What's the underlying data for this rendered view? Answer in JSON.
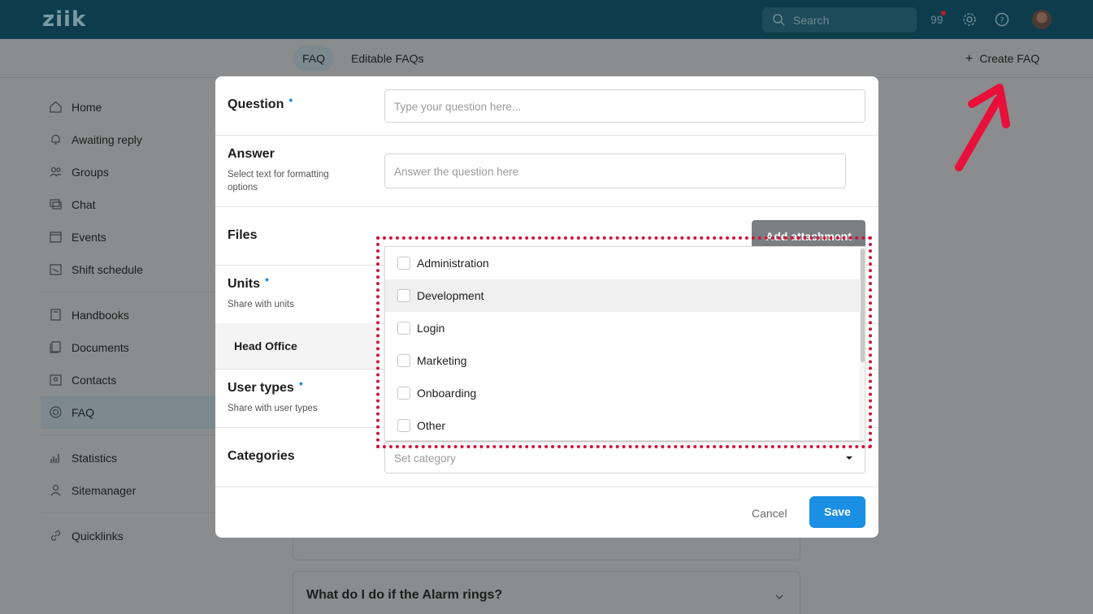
{
  "app": {
    "logo": "ziik"
  },
  "topbar": {
    "search_placeholder": "Search",
    "notification_count": "99",
    "icons": [
      "search-icon",
      "gear-icon",
      "help-icon"
    ]
  },
  "tabs": [
    {
      "label": "FAQ",
      "active": true
    },
    {
      "label": "Editable FAQs",
      "active": false
    }
  ],
  "create_faq_label": "Create FAQ",
  "sidebar": {
    "items": [
      {
        "label": "Home",
        "icon": "home-icon"
      },
      {
        "label": "Awaiting reply",
        "icon": "bell-icon"
      },
      {
        "label": "Groups",
        "icon": "users-icon"
      },
      {
        "label": "Chat",
        "icon": "chat-icon"
      },
      {
        "label": "Events",
        "icon": "calendar-icon"
      },
      {
        "label": "Shift schedule",
        "icon": "schedule-icon"
      },
      {
        "label": "Handbooks",
        "icon": "book-icon"
      },
      {
        "label": "Documents",
        "icon": "documents-icon"
      },
      {
        "label": "Contacts",
        "icon": "contacts-icon"
      },
      {
        "label": "FAQ",
        "icon": "faq-icon",
        "active": true
      },
      {
        "label": "Statistics",
        "icon": "statistics-icon"
      },
      {
        "label": "Sitemanager",
        "icon": "sitemanager-icon"
      },
      {
        "label": "Quicklinks",
        "icon": "link-icon"
      }
    ]
  },
  "background": {
    "question_visible": "What do I do if the Alarm rings?"
  },
  "modal": {
    "question_label": "Question",
    "question_placeholder": "Type your question here...",
    "answer_label": "Answer",
    "answer_hint": "Select text for formatting options",
    "answer_placeholder": "Answer the question here",
    "files_label": "Files",
    "add_attachment_label": "Add attachment",
    "units_label": "Units",
    "units_hint": "Share with units",
    "unit_value": "Head Office",
    "user_types_label": "User types",
    "user_types_hint": "Share with user types",
    "categories_label": "Categories",
    "categories_placeholder": "Set category",
    "cancel_label": "Cancel",
    "save_label": "Save"
  },
  "dropdown": {
    "options": [
      "Administration",
      "Development",
      "Login",
      "Marketing",
      "Onboarding",
      "Other"
    ],
    "hovered": "Development"
  },
  "colors": {
    "accent": "#1a8fe3",
    "topbar": "#0d3d4d",
    "highlight": "#d1133a",
    "arrow": "#e8103a"
  }
}
